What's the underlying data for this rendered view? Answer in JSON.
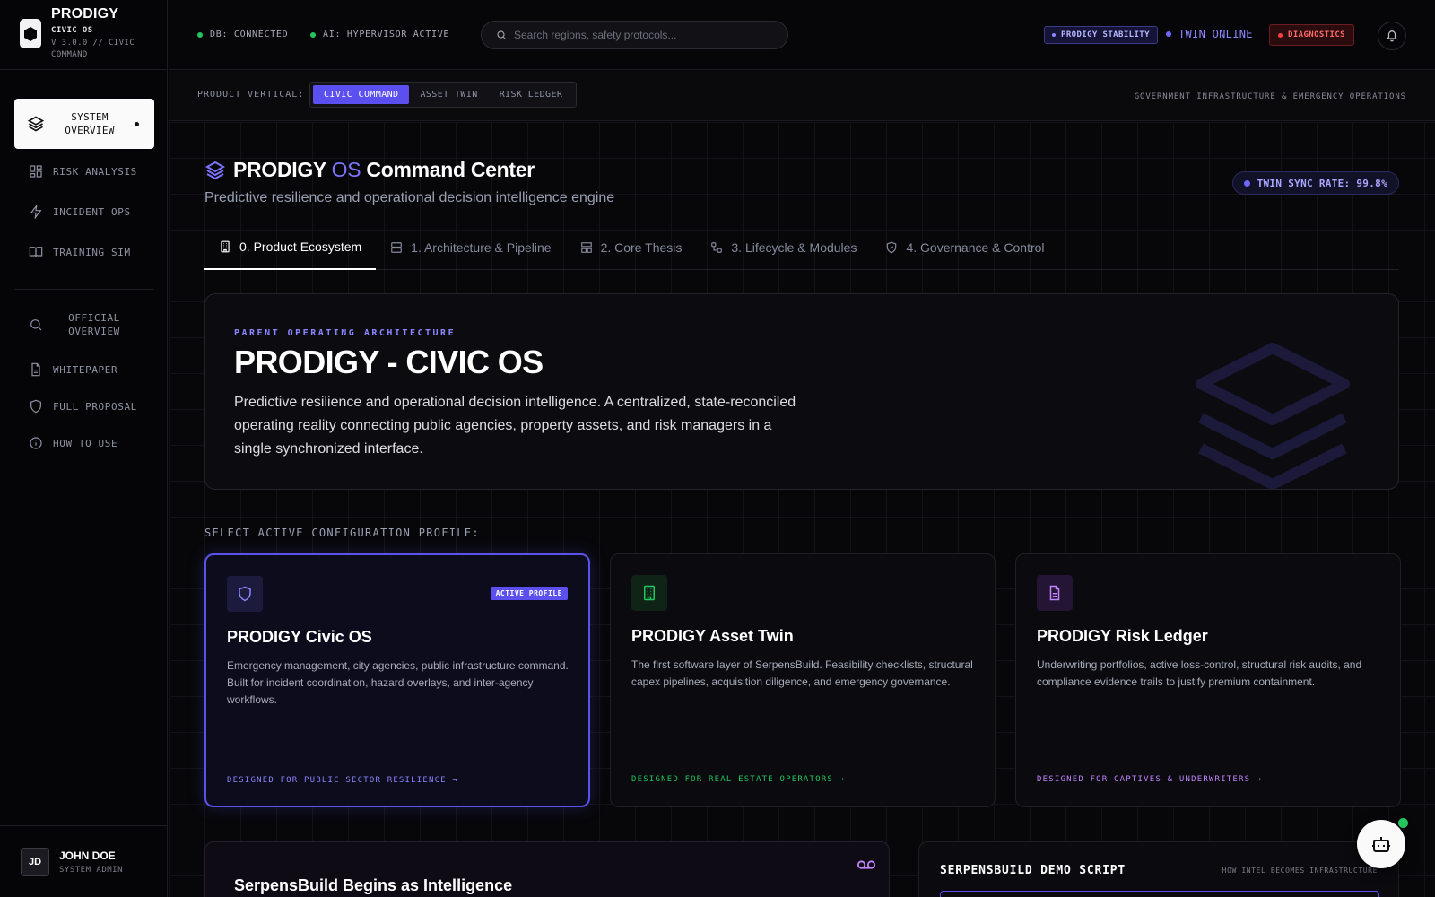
{
  "brand": {
    "name": "PRODIGY",
    "sub": "CIVIC OS",
    "version": "V 3.0.0 // CIVIC COMMAND"
  },
  "sidebar": {
    "active": {
      "label": "SYSTEM OVERVIEW",
      "icon": "layers-icon"
    },
    "items": [
      {
        "label": "RISK ANALYSIS",
        "icon": "dashboard-icon"
      },
      {
        "label": "INCIDENT OPS",
        "icon": "zap-icon"
      },
      {
        "label": "TRAINING SIM",
        "icon": "book-icon"
      }
    ],
    "docs": [
      {
        "label": "OFFICIAL OVERVIEW",
        "icon": "search-icon"
      },
      {
        "label": "WHITEPAPER",
        "icon": "file-icon"
      },
      {
        "label": "FULL PROPOSAL",
        "icon": "shield-icon"
      },
      {
        "label": "HOW TO USE",
        "icon": "info-icon"
      }
    ]
  },
  "user": {
    "initials": "JD",
    "name": "JOHN DOE",
    "role": "SYSTEM ADMIN"
  },
  "topbar": {
    "db_status": "DB: CONNECTED",
    "ai_status": "AI: HYPERVISOR ACTIVE",
    "search_placeholder": "Search regions, safety protocols...",
    "stability_badge": "PRODIGY STABILITY",
    "twin_status": "TWIN ONLINE",
    "diagnostics": "DIAGNOSTICS"
  },
  "vertical": {
    "label": "PRODUCT VERTICAL:",
    "options": [
      "CIVIC COMMAND",
      "ASSET TWIN",
      "RISK LEDGER"
    ],
    "selected": "CIVIC COMMAND",
    "right_label": "GOVERNMENT INFRASTRUCTURE & EMERGENCY OPERATIONS"
  },
  "header": {
    "title_pre": "PRODIGY",
    "title_os": "OS",
    "title_post": "Command Center",
    "subtitle": "Predictive resilience and operational decision intelligence engine",
    "sync": "TWIN SYNC RATE: 99.8%"
  },
  "tabs": [
    {
      "label": "0. Product Ecosystem",
      "icon": "building-icon"
    },
    {
      "label": "1. Architecture & Pipeline",
      "icon": "server-icon"
    },
    {
      "label": "2. Core Thesis",
      "icon": "layout-icon"
    },
    {
      "label": "3. Lifecycle & Modules",
      "icon": "workflow-icon"
    },
    {
      "label": "4. Governance & Control",
      "icon": "shield-check-icon"
    }
  ],
  "hero": {
    "kicker": "PARENT OPERATING ARCHITECTURE",
    "title": "PRODIGY - CIVIC OS",
    "desc": "Predictive resilience and operational decision intelligence. A centralized, state-reconciled operating reality connecting public agencies, property assets, and risk managers in a single synchronized interface."
  },
  "config": {
    "label": "SELECT ACTIVE CONFIGURATION PROFILE:",
    "active_badge": "ACTIVE PROFILE",
    "cards": [
      {
        "title": "PRODIGY Civic OS",
        "desc": "Emergency management, city agencies, public infrastructure command. Built for incident coordination, hazard overlays, and inter-agency workflows.",
        "foot": "DESIGNED FOR PUBLIC SECTOR RESILIENCE →",
        "accent": "#8b85ff",
        "icon": "shield-icon"
      },
      {
        "title": "PRODIGY Asset Twin",
        "desc": "The first software layer of SerpensBuild. Feasibility checklists, structural capex pipelines, acquisition diligence, and emergency governance.",
        "foot": "DESIGNED FOR REAL ESTATE OPERATORS →",
        "accent": "#22c55e",
        "icon": "building-icon"
      },
      {
        "title": "PRODIGY Risk Ledger",
        "desc": "Underwriting portfolios, active loss-control, structural risk audits, and compliance evidence trails to justify premium containment.",
        "foot": "DESIGNED FOR CAPTIVES & UNDERWRITERS →",
        "accent": "#c084fc",
        "icon": "file-icon"
      }
    ]
  },
  "bottom": {
    "left_title": "SerpensBuild Begins as Intelligence",
    "right_title": "SERPENSBUILD DEMO SCRIPT",
    "right_sub": "HOW INTEL BECOMES INFRASTRUCTURE"
  },
  "colors": {
    "accent": "#5b4ff0",
    "ok": "#22c55e",
    "danger": "#ff4040"
  }
}
